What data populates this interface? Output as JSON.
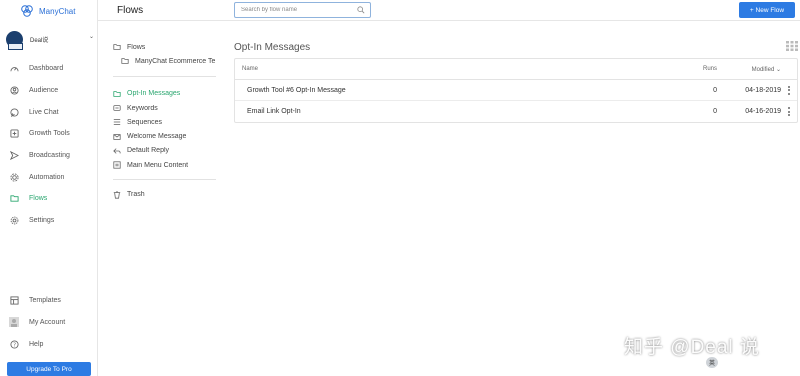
{
  "brand": {
    "name": "ManyChat"
  },
  "account": {
    "name": "Deal说"
  },
  "sidebar": {
    "items": [
      {
        "label": "Dashboard",
        "icon": "dashboard-icon"
      },
      {
        "label": "Audience",
        "icon": "audience-icon"
      },
      {
        "label": "Live Chat",
        "icon": "live-chat-icon"
      },
      {
        "label": "Growth Tools",
        "icon": "growth-tools-icon"
      },
      {
        "label": "Broadcasting",
        "icon": "broadcasting-icon"
      },
      {
        "label": "Automation",
        "icon": "automation-icon"
      },
      {
        "label": "Flows",
        "icon": "flows-icon",
        "active": true
      },
      {
        "label": "Settings",
        "icon": "settings-icon"
      }
    ],
    "bottom": [
      {
        "label": "Templates",
        "icon": "templates-icon"
      },
      {
        "label": "My Account",
        "icon": "my-account-icon"
      },
      {
        "label": "Help",
        "icon": "help-icon"
      }
    ],
    "upgrade_label": "Upgrade To Pro"
  },
  "header": {
    "title": "Flows",
    "search_placeholder": "Search by flow name",
    "new_flow_label": "+ New Flow"
  },
  "folders": {
    "root": "Flows",
    "sub": "ManyChat Ecommerce Te",
    "items": [
      "Opt-In Messages",
      "Keywords",
      "Sequences",
      "Welcome Message",
      "Default Reply",
      "Main Menu Content"
    ],
    "trash": "Trash"
  },
  "main": {
    "title": "Opt-In Messages",
    "columns": {
      "name": "Name",
      "runs": "Runs",
      "modified": "Modified"
    },
    "rows": [
      {
        "name": "Growth Tool #6 Opt-In Message",
        "runs": "0",
        "modified": "04-18-2019"
      },
      {
        "name": "Email Link Opt-In",
        "runs": "0",
        "modified": "04-16-2019"
      }
    ]
  },
  "watermark": {
    "text": "知乎 @Deal 说",
    "ime": "英"
  },
  "colors": {
    "accent": "#2d7be3",
    "active": "#2aa66f",
    "border": "#e3e3e3"
  }
}
